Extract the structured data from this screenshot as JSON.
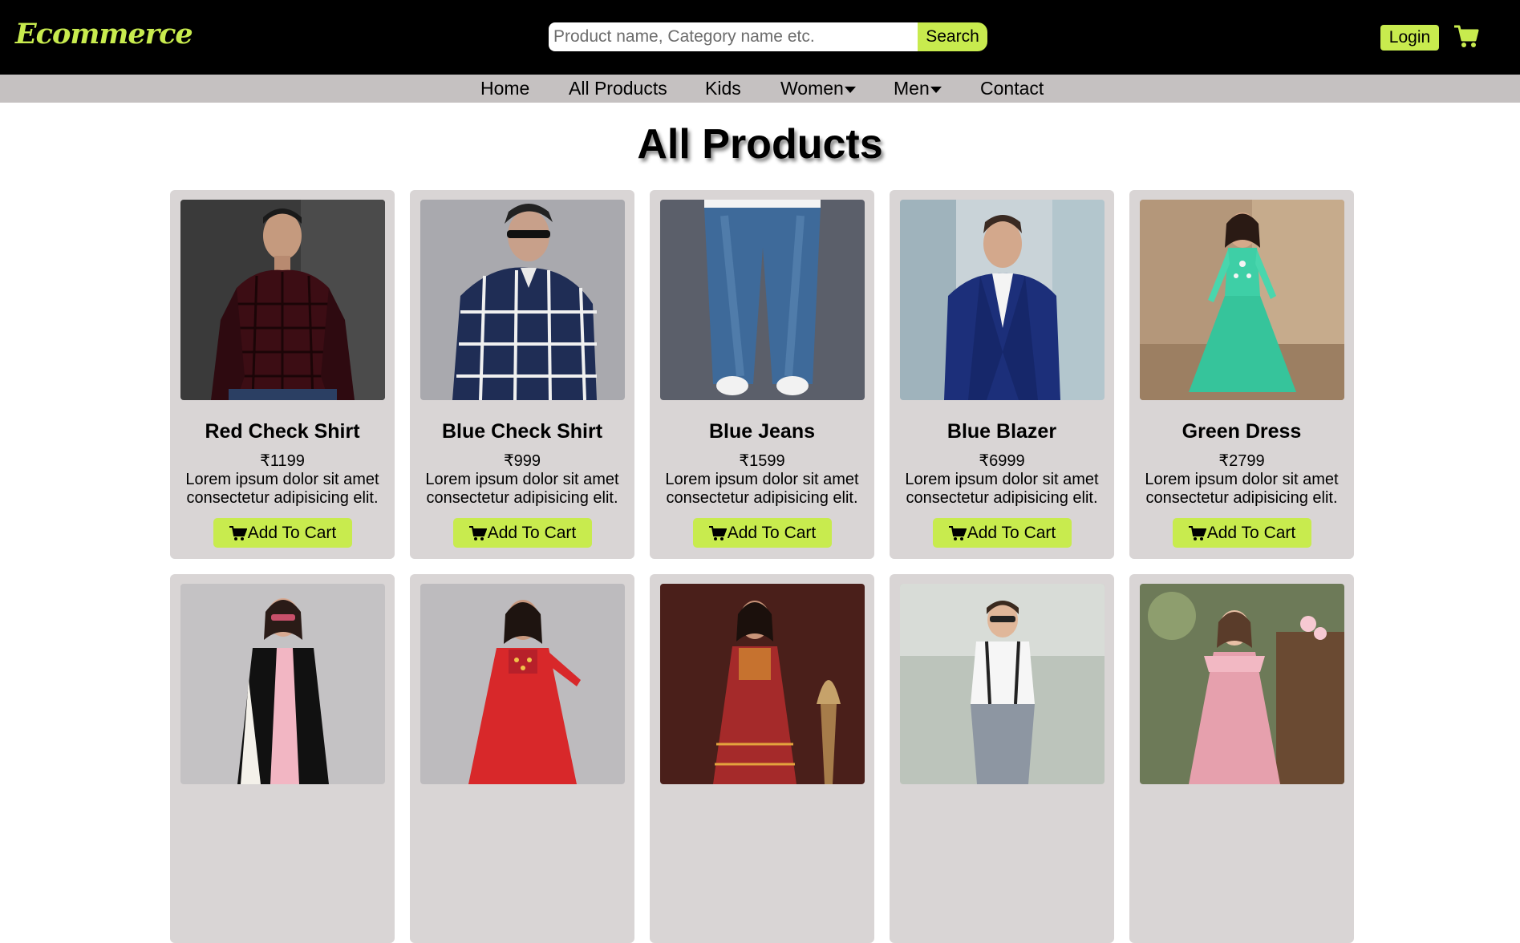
{
  "brand": {
    "logo_text": "Ecommerce",
    "accent_color": "#c8eb4e"
  },
  "header": {
    "search": {
      "placeholder": "Product name, Category name etc.",
      "value": "",
      "button_label": "Search"
    },
    "login_label": "Login",
    "cart_icon": "cart-icon"
  },
  "nav": {
    "items": [
      {
        "label": "Home"
      },
      {
        "label": "All Products"
      },
      {
        "label": "Kids"
      },
      {
        "label": "Women",
        "dropdown": true
      },
      {
        "label": "Men",
        "dropdown": true
      },
      {
        "label": "Contact"
      }
    ]
  },
  "main": {
    "title": "All Products",
    "products": [
      {
        "name": "Red Check Shirt",
        "price": "₹1199",
        "desc": "Lorem ipsum dolor sit amet consectetur adipisicing elit.",
        "button": "Add To Cart"
      },
      {
        "name": "Blue Check Shirt",
        "price": "₹999",
        "desc": "Lorem ipsum dolor sit amet consectetur adipisicing elit.",
        "button": "Add To Cart"
      },
      {
        "name": "Blue Jeans",
        "price": "₹1599",
        "desc": "Lorem ipsum dolor sit amet consectetur adipisicing elit.",
        "button": "Add To Cart"
      },
      {
        "name": "Blue Blazer",
        "price": "₹6999",
        "desc": "Lorem ipsum dolor sit amet consectetur adipisicing elit.",
        "button": "Add To Cart"
      },
      {
        "name": "Green Dress",
        "price": "₹2799",
        "desc": "Lorem ipsum dolor sit amet consectetur adipisicing elit.",
        "button": "Add To Cart"
      }
    ]
  }
}
